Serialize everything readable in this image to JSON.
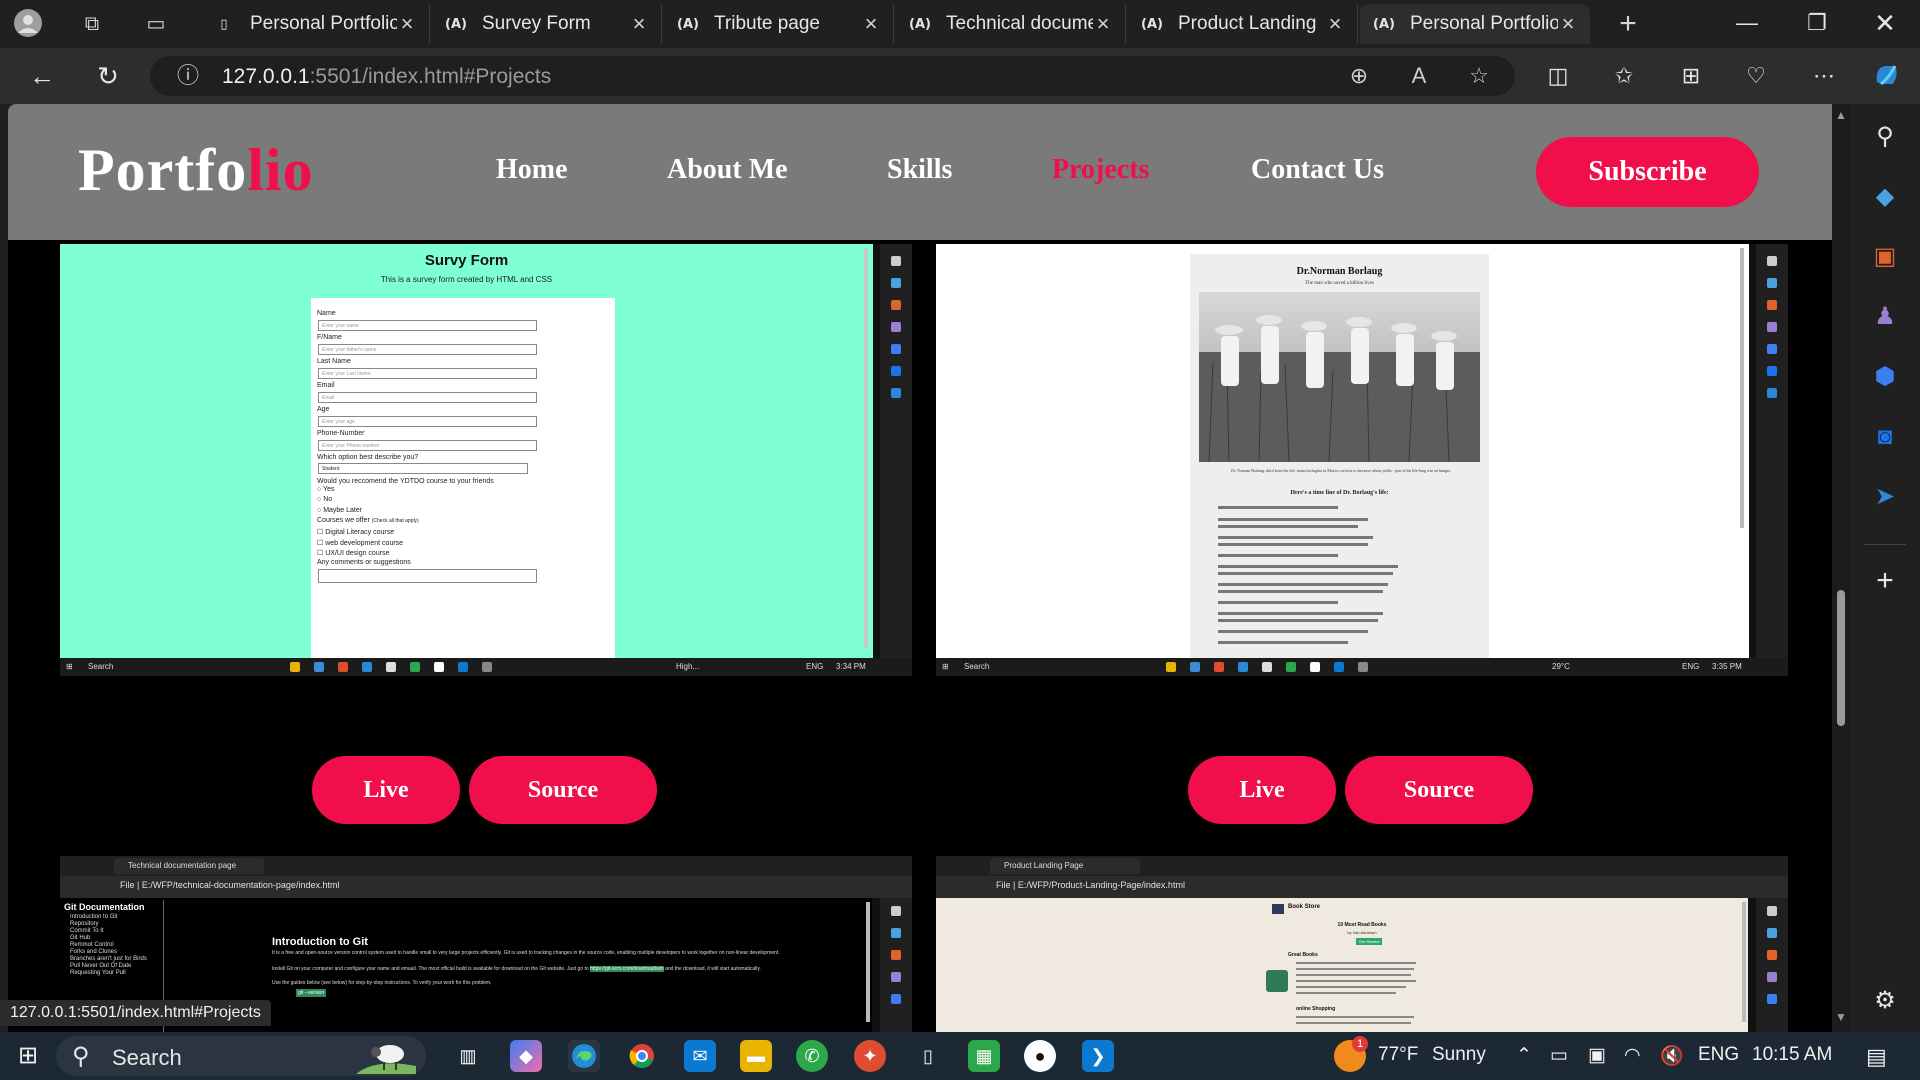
{
  "browser": {
    "tabs": [
      {
        "label": "Personal Portfolio",
        "favicon": "page-icon",
        "active": false
      },
      {
        "label": "Survey Form",
        "favicon": "freecodecamp-icon",
        "active": false
      },
      {
        "label": "Tribute page",
        "favicon": "freecodecamp-icon",
        "active": false
      },
      {
        "label": "Technical documentation",
        "favicon": "freecodecamp-icon",
        "active": false
      },
      {
        "label": "Product Landing",
        "favicon": "freecodecamp-icon",
        "active": false
      },
      {
        "label": "Personal Portfolio",
        "favicon": "freecodecamp-icon",
        "active": true
      }
    ],
    "favicon_glyph": "(A)",
    "url_host": "127.0.0.1",
    "url_rest": ":5501/index.html#Projects",
    "status_url": "127.0.0.1:5501/index.html#Projects"
  },
  "site": {
    "logo_main": "Portfo",
    "logo_accent": "lio",
    "nav": [
      {
        "label": "Home",
        "active": false
      },
      {
        "label": "About Me",
        "active": false
      },
      {
        "label": "Skills",
        "active": false
      },
      {
        "label": "Projects",
        "active": true
      },
      {
        "label": "Contact Us",
        "active": false
      }
    ],
    "subscribe": "Subscribe",
    "accent_color": "#f00f4b",
    "header_bg": "#7a7a7a"
  },
  "projects": {
    "live_label": "Live",
    "source_label": "Source",
    "survey": {
      "title": "Survy Form",
      "subtitle": "This is a survey form created by HTML and CSS",
      "fields": [
        {
          "label": "Name",
          "placeholder": "Enter your name"
        },
        {
          "label": "F/Name",
          "placeholder": "Enter your father's name"
        },
        {
          "label": "Last Name",
          "placeholder": "Enter your Last Name"
        },
        {
          "label": "Email",
          "placeholder": "Email"
        },
        {
          "label": "Age",
          "placeholder": "Enter your age"
        },
        {
          "label": "Phone-Number",
          "placeholder": "Enter your Phone-number"
        }
      ],
      "select_label": "Which option best describe you?",
      "select_value": "Student",
      "radio_question": "Would you reccomend the YDTDO course to your friends",
      "radios": [
        "Yes",
        "No",
        "Maybe Later"
      ],
      "courses_label": "Courses we offer",
      "courses_hint": "(Check all that apply)",
      "courses": [
        "Digital Literacy course",
        "web development course",
        "UX/UI design course"
      ],
      "comments_label": "Any comments or suggestions",
      "task_search": "Search",
      "task_weather": "High...",
      "task_lang": "ENG",
      "task_time": "3:34 PM"
    },
    "tribute": {
      "title": "Dr.Norman Borlaug",
      "subtitle": "The man who saved a billion lives",
      "caption": "Dr. Norman Borlaug, third from the left, trains biologists in Mexico on how to increase wheat yields - part of his life-long war on hunger.",
      "timeline_heading": "Here's a time line of Dr. Borlaug's life:",
      "task_search": "Search",
      "task_weather": "29°C",
      "task_lang": "ENG",
      "task_time": "3:35 PM"
    },
    "techdoc": {
      "tab": "Technical documentation page",
      "url_prefix": "File",
      "url": "E:/WFP/technical-documentation-page/index.html",
      "nav_title": "Git Documentation",
      "nav_items": [
        "Introduction to Git",
        "Repository",
        "Commit To It",
        "Git Hub",
        "Remmot Control",
        "Forks and Clones",
        "Branches aren't just for Birds",
        "Pull Never Out Of Date",
        "Requesting Your Pull"
      ],
      "heading": "Introduction to Git",
      "para1": "It is a free and open-source version control system used to handle small to very large projects efficiently. Git is used to tracking changes in the source code, enabling multiple developers to work together on non-linear development.",
      "para2": "Install Git on your computer and configure your name and emaail. The most official build is available for download on the Git website. Just go to",
      "link": "https://git-scm.com/download/win",
      "para2b": "and the download, it will start automatically.",
      "para3": "Use the guides below (see below) for step-by-step instructions. To verify your work for this problem,",
      "code": "git --version"
    },
    "landing": {
      "tab": "Product Landing Page",
      "url_prefix": "File",
      "url": "E:/WFP/Product-Landing-Page/index.html",
      "brand": "Book Store",
      "hero": "10 Must Read Books",
      "hero_sub": "by Vah Abraham",
      "button": "Get Started",
      "section": "Great Books",
      "section2": "online Shopping"
    }
  },
  "taskbar": {
    "search": "Search",
    "weather_temp": "77°F",
    "weather_desc": "Sunny",
    "lang": "ENG",
    "time": "10:15 AM",
    "weather_badge": "1"
  }
}
